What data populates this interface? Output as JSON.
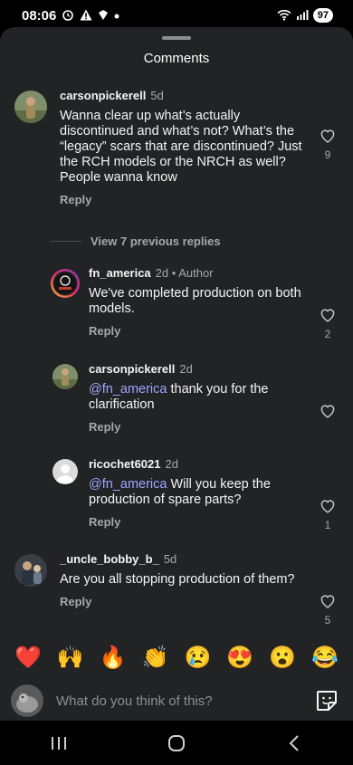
{
  "status_bar": {
    "time": "08:06",
    "battery": "97"
  },
  "sheet": {
    "title": "Comments"
  },
  "comments": [
    {
      "username": "carsonpickerell",
      "time": "5d",
      "text": "Wanna clear up what’s actually discontinued and what’s not? What’s the “legacy” scars that are discontinued? Just the RCH models or the NRCH as well?  People wanna know",
      "reply": "Reply",
      "likes": "9"
    },
    {
      "username": "fn_america",
      "time": "2d",
      "author_tag": "• Author",
      "text": "We've completed production on both models.",
      "reply": "Reply",
      "likes": "2"
    },
    {
      "username": "carsonpickerell",
      "time": "2d",
      "mention": "@fn_america",
      "text": " thank you for the clarification",
      "reply": "Reply"
    },
    {
      "username": "ricochet6021",
      "time": "2d",
      "mention": "@fn_america",
      "text": " Will you keep the production of spare parts?",
      "reply": "Reply",
      "likes": "1"
    },
    {
      "username": "_uncle_bobby_b_",
      "time": "5d",
      "text": "Are you all stopping production of them?",
      "reply": "Reply",
      "likes": "5"
    }
  ],
  "view_replies": "View 7 previous replies",
  "emojis": [
    "❤️",
    "🙌",
    "🔥",
    "👏",
    "😢",
    "😍",
    "😮",
    "😂"
  ],
  "composer": {
    "placeholder": "What do you think of this?"
  },
  "colors": {
    "sheet_bg": "#212325",
    "mention": "#a0a6ff",
    "muted": "#a8a8a8"
  }
}
